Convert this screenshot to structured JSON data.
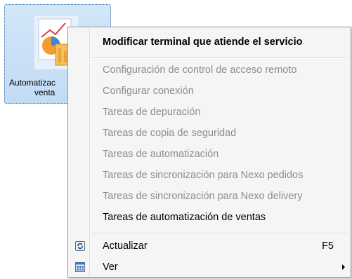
{
  "desktop_icon": {
    "label_line1": "Automatizac",
    "label_line2": "venta",
    "icon": "chart-document-icon"
  },
  "context_menu": {
    "items": [
      {
        "label": "Modificar terminal que atiende el servicio",
        "state": "enabled",
        "bold": true
      },
      {
        "label": "Configuración de control de acceso remoto",
        "state": "disabled"
      },
      {
        "label": "Configurar conexión",
        "state": "disabled"
      },
      {
        "label": "Tareas de depuración",
        "state": "disabled"
      },
      {
        "label": "Tareas de copia de seguridad",
        "state": "disabled"
      },
      {
        "label": "Tareas de automatización",
        "state": "disabled"
      },
      {
        "label": "Tareas de sincronización para Nexo pedidos",
        "state": "disabled"
      },
      {
        "label": "Tareas de sincronización para Nexo delivery",
        "state": "disabled"
      },
      {
        "label": "Tareas de automatización de ventas",
        "state": "enabled"
      },
      {
        "label": "Actualizar",
        "shortcut": "F5",
        "icon": "refresh-icon",
        "state": "enabled"
      },
      {
        "label": "Ver",
        "icon": "view-icon",
        "has_submenu": true,
        "state": "enabled"
      }
    ]
  },
  "colors": {
    "menu_background": "#f5f5f5",
    "disabled_text": "#8d8d8d",
    "selection_fill": "#c9e0f7"
  }
}
